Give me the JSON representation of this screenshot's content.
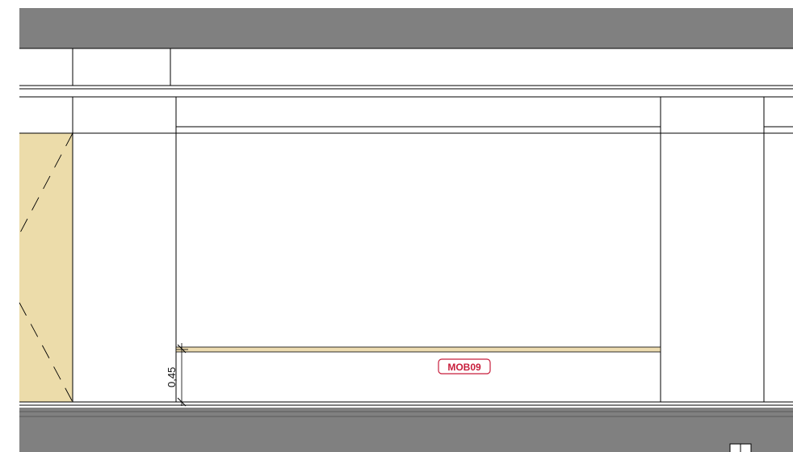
{
  "colors": {
    "background": "#ffffff",
    "wall_section_fill": "#808080",
    "line": "#000000",
    "material_fill": "#ecdcaa",
    "shelf_fill": "#eddcb0",
    "tag": "#c81e3c"
  },
  "dimension": {
    "value": "0,45"
  },
  "tag": {
    "label": "MOB09"
  },
  "icons": {
    "corner": "panel-icon"
  }
}
